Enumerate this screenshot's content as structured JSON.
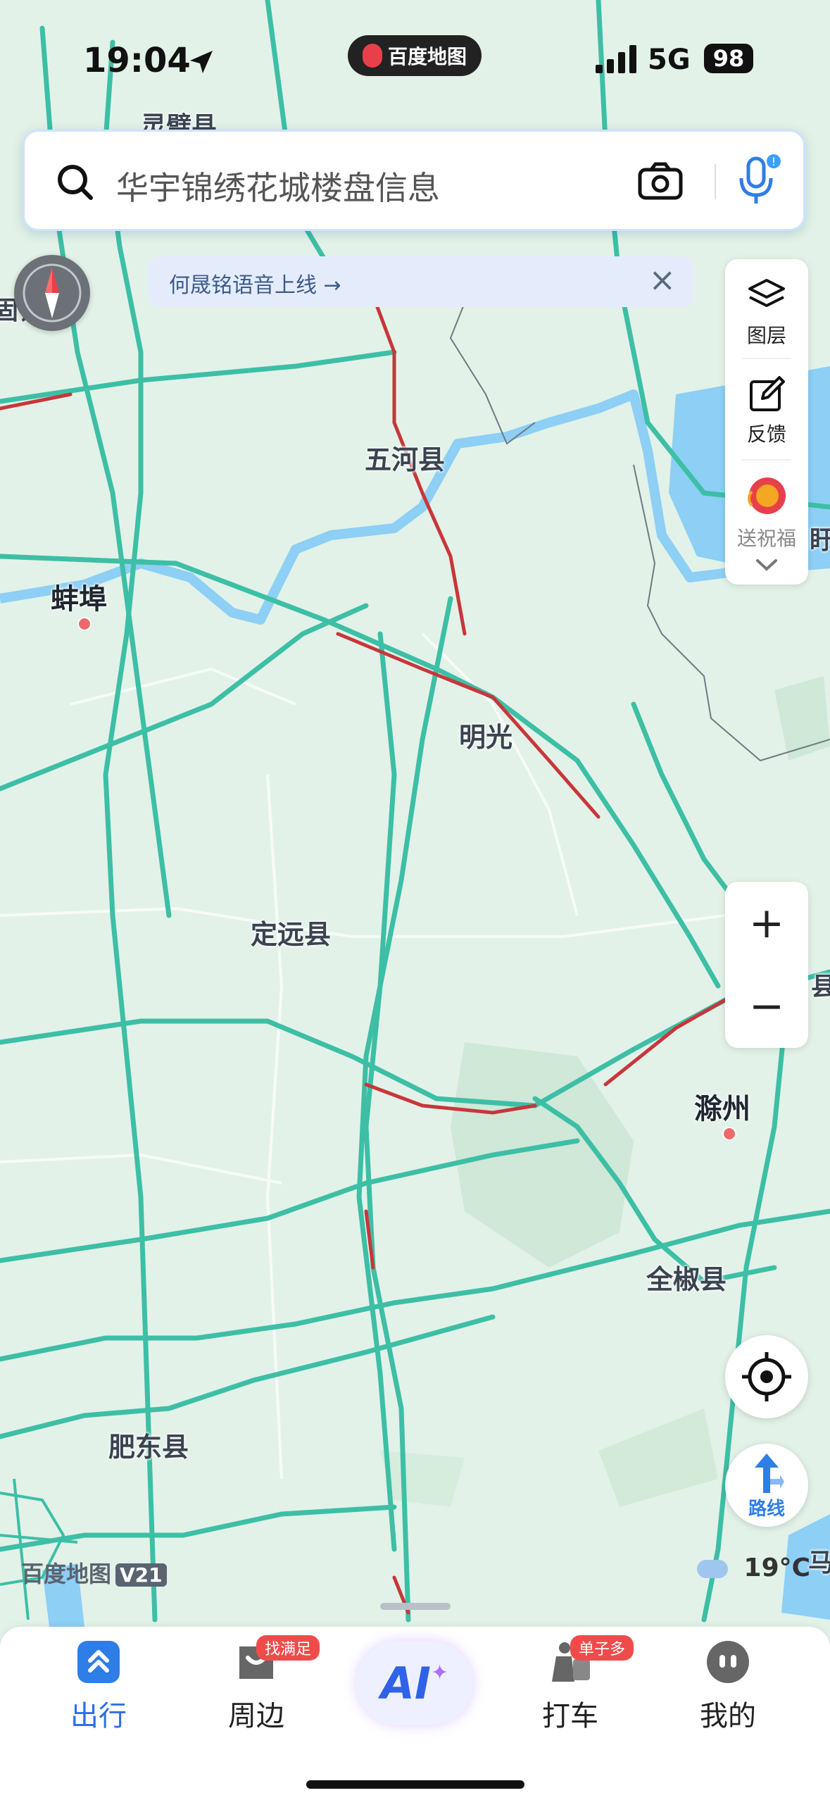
{
  "status_bar": {
    "time": "19:04",
    "app_badge": "百度地图",
    "network": "5G",
    "battery": "98"
  },
  "search": {
    "placeholder": "华宇锦绣花城楼盘信息"
  },
  "notice": {
    "text": "何晟铭语音上线 →",
    "close": "×"
  },
  "tools": {
    "layers": "图层",
    "feedback": "反馈",
    "bless": "送祝福"
  },
  "zoom": {
    "plus": "+",
    "minus": "−"
  },
  "route_label": "路线",
  "weather": "19°C",
  "brand": {
    "name": "百度地图",
    "version": "V21"
  },
  "map": {
    "cities": [
      {
        "name": "蚌埠"
      },
      {
        "name": "滁州"
      }
    ],
    "counties": [
      {
        "name": "五河县"
      },
      {
        "name": "明光"
      },
      {
        "name": "定远县"
      },
      {
        "name": "全椒县"
      },
      {
        "name": "肥东县"
      }
    ],
    "edge_labels": [
      "灵璧县",
      "固镇县",
      "盱",
      "县",
      "马"
    ],
    "colors": {
      "land": "#e2f2e8",
      "road": "#3dbfa6",
      "water": "#8dcff5",
      "congestion": "#c8363a"
    }
  },
  "nav": {
    "items": [
      {
        "label": "出行",
        "active": true
      },
      {
        "label": "周边",
        "tag": "找满足"
      },
      {
        "label": "AI"
      },
      {
        "label": "打车",
        "tag": "单子多"
      },
      {
        "label": "我的"
      }
    ]
  }
}
